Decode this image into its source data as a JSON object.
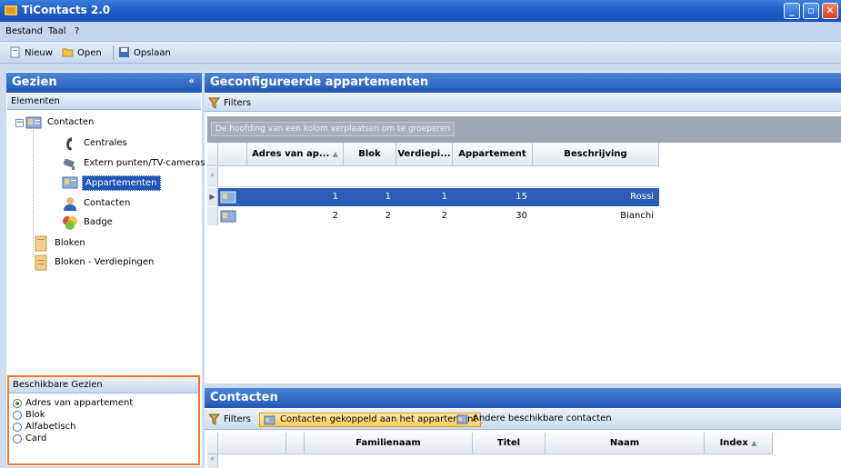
{
  "window": {
    "title": "TiContacts 2.0"
  },
  "menu": {
    "items": [
      "Bestand",
      "Taal",
      "?"
    ]
  },
  "toolbar": {
    "new_label": "Nieuw",
    "open_label": "Open",
    "save_label": "Opslaan"
  },
  "left": {
    "header": "Gezien",
    "elements_label": "Elementen",
    "tree": {
      "root": "Contacten",
      "children": [
        "Centrales",
        "Extern punten/TV-cameras",
        "Appartementen",
        "Contacten",
        "Badge"
      ],
      "others": [
        "Bloken",
        "Bloken - Verdiepingen"
      ]
    },
    "views": {
      "header": "Beschikbare Gezien",
      "options": [
        "Adres van appartement",
        "Blok",
        "Alfabetisch",
        "Card"
      ],
      "selected": "Adres van appartement"
    }
  },
  "main": {
    "header": "Geconfigureerde appartementen",
    "filters_label": "Filters",
    "group_hint": "De hoofding van een kolom verplaatsen om te groeperen",
    "columns": [
      "Adres van ap...",
      "Blok",
      "Verdiepi...",
      "Appartement",
      "Beschrijving"
    ],
    "rows": [
      {
        "adres": "1",
        "blok": "1",
        "verdieping": "1",
        "appartement": "15",
        "beschrijving": "Rossi"
      },
      {
        "adres": "2",
        "blok": "2",
        "verdieping": "2",
        "appartement": "30",
        "beschrijving": "Bianchi"
      }
    ]
  },
  "contacts": {
    "header": "Contacten",
    "filters_label": "Filters",
    "tab_linked": "Contacten gekoppeld aan het appartement",
    "tab_other": "Andere beschikbare contacten",
    "columns": [
      "Familienaam",
      "Titel",
      "Naam",
      "Index"
    ]
  },
  "colors": {
    "accent": "#2157b5",
    "selection": "#1f55b8",
    "highlight_border": "#f07a28"
  }
}
